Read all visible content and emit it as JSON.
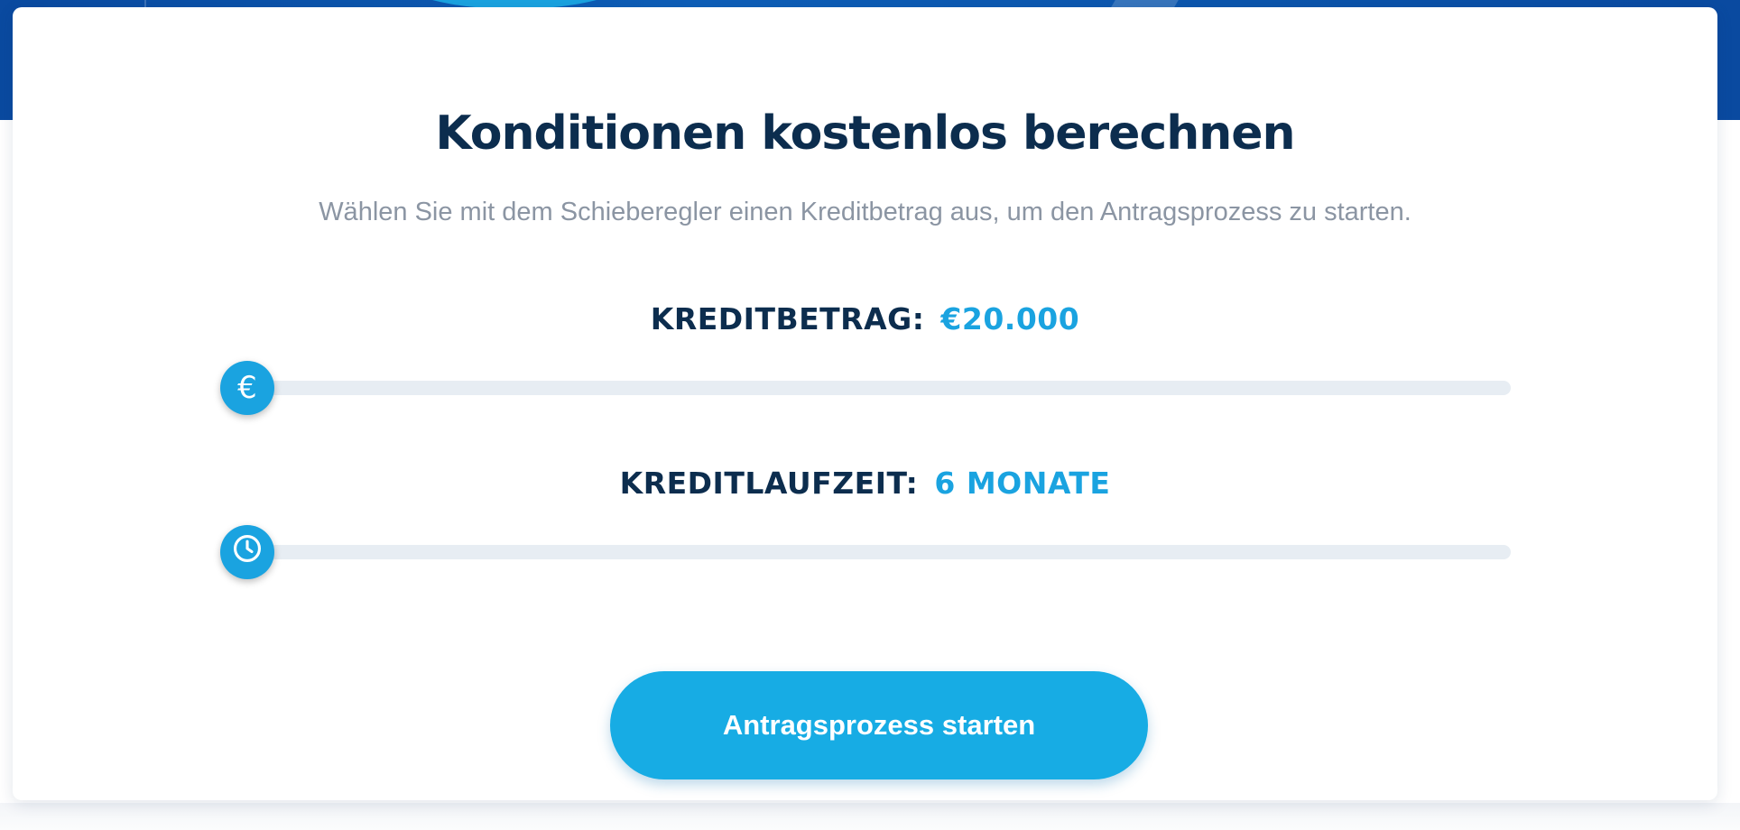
{
  "calculator": {
    "title": "Konditionen kostenlos berechnen",
    "subtitle": "Wählen Sie mit dem Schieberegler einen Kreditbetrag aus, um den Antragsprozess zu starten.",
    "amount": {
      "label": "KREDITBETRAG:",
      "value": "€20.000",
      "level": 0,
      "icon": "euro-icon",
      "icon_glyph": "€"
    },
    "term": {
      "label": "KREDITLAUFZEIT:",
      "value": "6 MONATE",
      "level": 0,
      "icon": "clock-icon"
    },
    "start_button": "Antragsprozess starten"
  },
  "colors": {
    "primary": "#1aa3e0",
    "heading": "#0c2d4e",
    "muted": "#8b95a3",
    "track": "#e7edf3",
    "hero_blue": "#0a4aa0"
  }
}
